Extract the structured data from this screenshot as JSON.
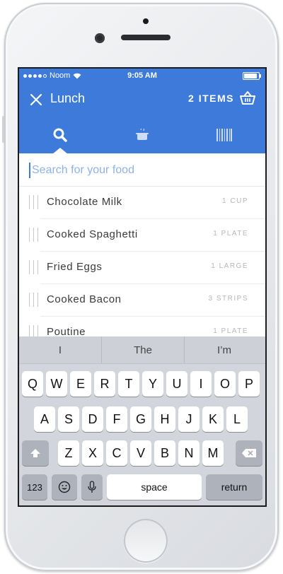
{
  "status": {
    "carrier": "Noom",
    "time": "9:05 AM"
  },
  "header": {
    "title": "Lunch",
    "items": "2 ITEMS"
  },
  "tabs": [
    "search",
    "cooking-pot",
    "barcode"
  ],
  "search": {
    "placeholder": "Search for your food"
  },
  "foods": [
    {
      "name": "Chocolate Milk",
      "qty": "1 CUP"
    },
    {
      "name": "Cooked Spaghetti",
      "qty": "1 PLATE"
    },
    {
      "name": "Fried Eggs",
      "qty": "1 LARGE"
    },
    {
      "name": "Cooked Bacon",
      "qty": "3 STRIPS"
    },
    {
      "name": "Poutine",
      "qty": "1 PLATE"
    }
  ],
  "keyboard": {
    "suggestions": [
      "I",
      "The",
      "I’m"
    ],
    "row1": [
      "Q",
      "W",
      "E",
      "R",
      "T",
      "Y",
      "U",
      "I",
      "O",
      "P"
    ],
    "row2": [
      "A",
      "S",
      "D",
      "F",
      "G",
      "H",
      "J",
      "K",
      "L"
    ],
    "row3": [
      "Z",
      "X",
      "C",
      "V",
      "B",
      "N",
      "M"
    ],
    "numbers": "123",
    "space": "space",
    "return": "return"
  },
  "colors": {
    "accent": "#3d7ad9",
    "keyboard_bg": "#d2d5db"
  }
}
